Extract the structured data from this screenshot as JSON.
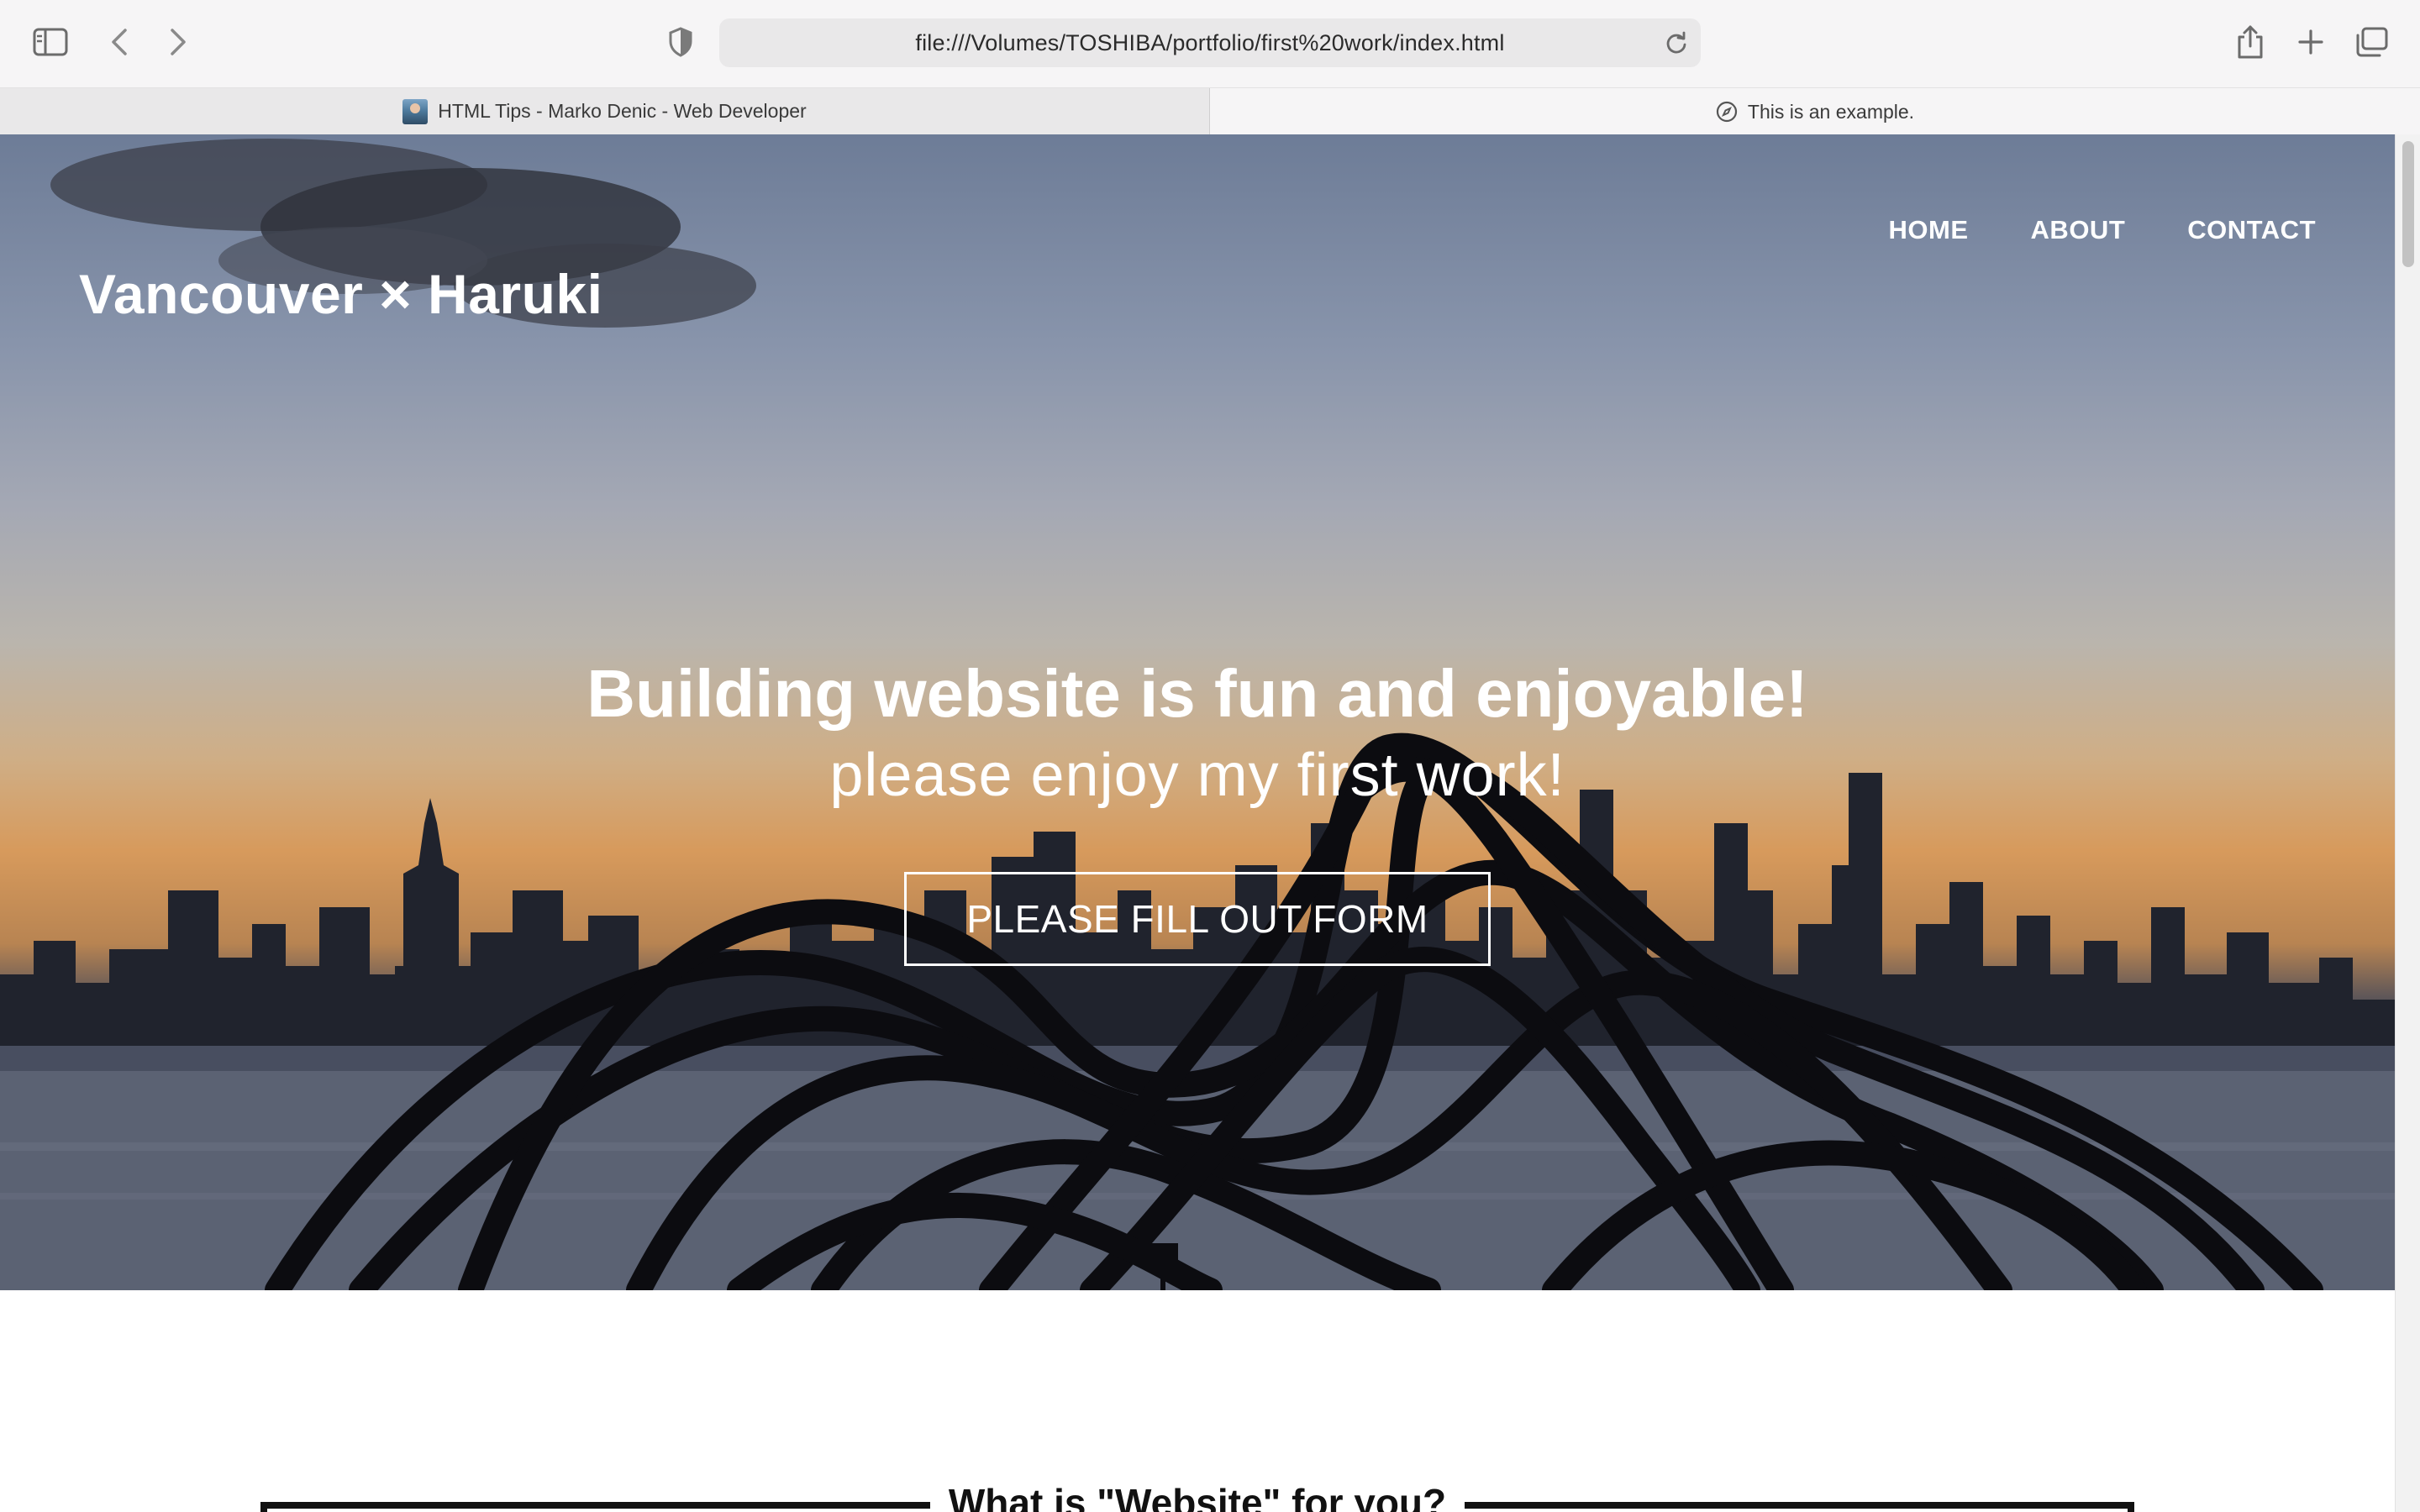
{
  "browser": {
    "url": "file:///Volumes/TOSHIBA/portfolio/first%20work/index.html",
    "tabs": [
      {
        "title": "HTML Tips - Marko Denic - Web Developer",
        "active": true
      },
      {
        "title": "This is an example.",
        "active": false
      }
    ],
    "icons": {
      "sidebar": "sidebar-icon",
      "back": "chevron-left-icon",
      "forward": "chevron-right-icon",
      "privacy": "shield-icon",
      "reload": "reload-icon",
      "share": "share-icon",
      "new_tab": "plus-icon",
      "tab_overview": "tabs-overview-icon"
    }
  },
  "site": {
    "logo": "Vancouver × Haruki",
    "nav": [
      "HOME",
      "ABOUT",
      "CONTACT"
    ],
    "hero": {
      "title": "Building website is fun and enjoyable!",
      "subtitle": "please enjoy my first work!",
      "cta": "PLEASE FILL OUT FORM"
    },
    "section_title": "What is \"Website\" for you?"
  },
  "colors": {
    "chrome_bg": "#f6f5f6",
    "url_bar_bg": "#e9e8e9",
    "hero_text": "#ffffff",
    "section_border": "#111111"
  }
}
